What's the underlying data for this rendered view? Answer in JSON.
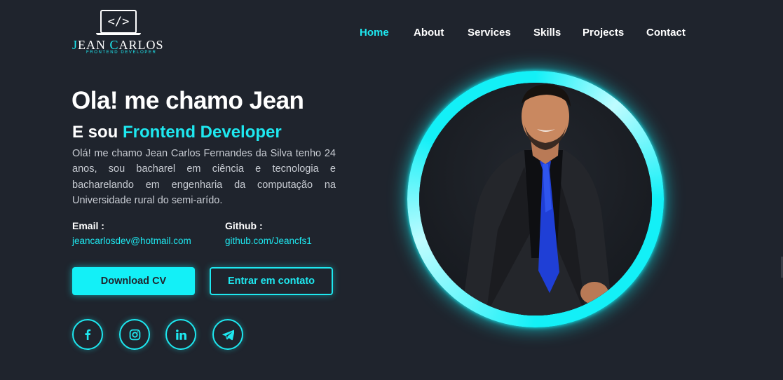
{
  "logo": {
    "icon_text": "</>",
    "name_first_cap": "J",
    "name_rest_first": "EAN ",
    "name_last_cap": "C",
    "name_rest_last": "ARLOS",
    "subtitle": "FRONTEND DEVELOPER"
  },
  "nav": {
    "items": [
      {
        "label": "Home",
        "active": true
      },
      {
        "label": "About",
        "active": false
      },
      {
        "label": "Services",
        "active": false
      },
      {
        "label": "Skills",
        "active": false
      },
      {
        "label": "Projects",
        "active": false
      },
      {
        "label": "Contact",
        "active": false
      }
    ]
  },
  "hero": {
    "title": "Ola! me chamo Jean",
    "subtitle_prefix": "E sou ",
    "subtitle_accent": "Frontend Developer",
    "description": "Olá! me chamo Jean Carlos Fernandes da Silva tenho 24 anos, sou bacharel em ciência e tecnologia e bacharelando em engenharia da computação na Universidade rural do semi-arído."
  },
  "contact_info": {
    "email_label": "Email :",
    "email_value": "jeancarlosdev@hotmail.com",
    "github_label": "Github :",
    "github_value": "github.com/Jeancfs1"
  },
  "buttons": {
    "download_cv": "Download CV",
    "contact": "Entrar em contato"
  },
  "social": [
    {
      "name": "facebook-icon"
    },
    {
      "name": "instagram-icon"
    },
    {
      "name": "linkedin-icon"
    },
    {
      "name": "telegram-icon"
    }
  ],
  "colors": {
    "background": "#1f242d",
    "accent": "#13f0f7",
    "text": "#ffffff",
    "muted_text": "#c8ccd3"
  }
}
